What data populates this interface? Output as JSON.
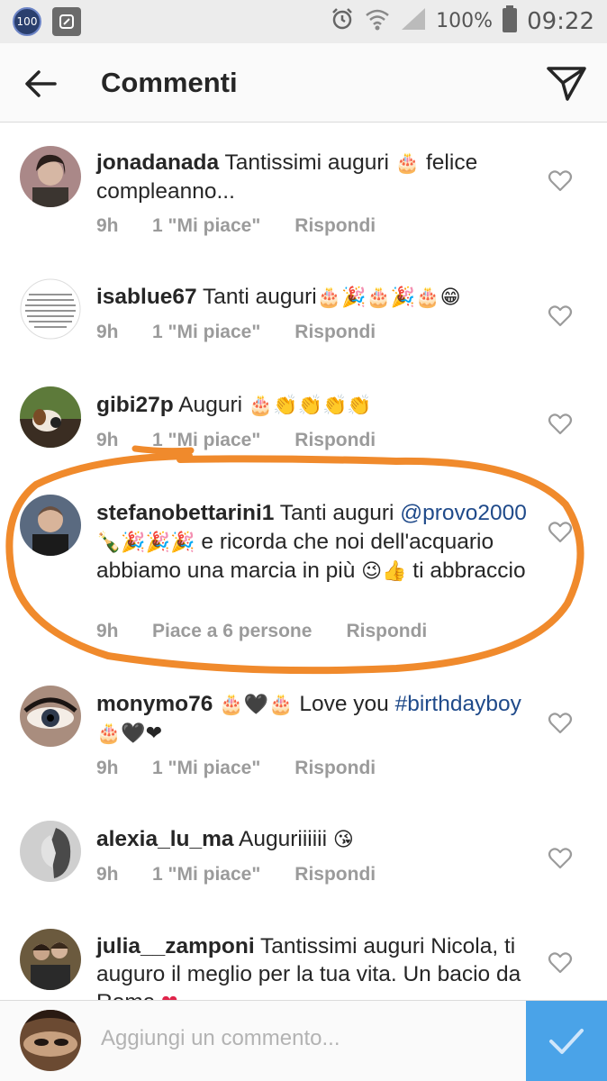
{
  "status_bar": {
    "notif_badge": "100",
    "battery": "100%",
    "time": "09:22"
  },
  "header": {
    "title": "Commenti"
  },
  "comments": [
    {
      "username": "jonadanada",
      "text_a": " Tantissimi auguri ",
      "emoji_a": "🎂",
      "text_b": " felice compleanno...",
      "time": "9h",
      "likes": "1 \"Mi piace\"",
      "reply": "Rispondi"
    },
    {
      "username": "isablue67",
      "text_a": " Tanti auguri",
      "emoji_a": "🎂🎉🎂🎉🎂😁",
      "time": "9h",
      "likes": "1 \"Mi piace\"",
      "reply": "Rispondi"
    },
    {
      "username": "gibi27p",
      "text_a": " Auguri ",
      "emoji_a": "🎂👏👏👏👏",
      "time": "9h",
      "likes": "1 \"Mi piace\"",
      "reply": "Rispondi"
    },
    {
      "username": "stefanobettarini1",
      "text_a": " Tanti auguri ",
      "mention": "@provo2000",
      "emoji_a": " 🍾🎉🎉🎉",
      "text_b": " e ricorda che noi dell'acquario abbiamo una marcia in più ",
      "emoji_b": "😉👍",
      "text_c": " ti abbraccio",
      "time": "9h",
      "likes": "Piace a 6 persone",
      "reply": "Rispondi"
    },
    {
      "username": "monymo76",
      "emoji_a": " 🎂🖤🎂",
      "text_a": " Love you ",
      "hashtag": "#birthdayboy",
      "emoji_b": " 🎂🖤❤",
      "time": "9h",
      "likes": "1 \"Mi piace\"",
      "reply": "Rispondi"
    },
    {
      "username": "alexia_lu_ma",
      "text_a": " Auguriiiiii ",
      "emoji_a": "😘",
      "time": "9h",
      "likes": "1 \"Mi piace\"",
      "reply": "Rispondi"
    },
    {
      "username": "julia__zamponi",
      "text_a": " Tantissimi auguri Nicola, ti auguro il meglio per la tua vita. Un bacio da Roma ",
      "emoji_a": "❤"
    }
  ],
  "footer": {
    "placeholder": "Aggiungi un commento..."
  },
  "colors": {
    "annotation": "#f08a2c",
    "submit": "#4aa3e8",
    "mention": "#1f4a8a"
  },
  "icons": [
    "back-arrow-icon",
    "send-icon",
    "heart-icon",
    "checkmark-icon",
    "alarm-icon",
    "wifi-icon",
    "signal-icon",
    "battery-icon"
  ]
}
